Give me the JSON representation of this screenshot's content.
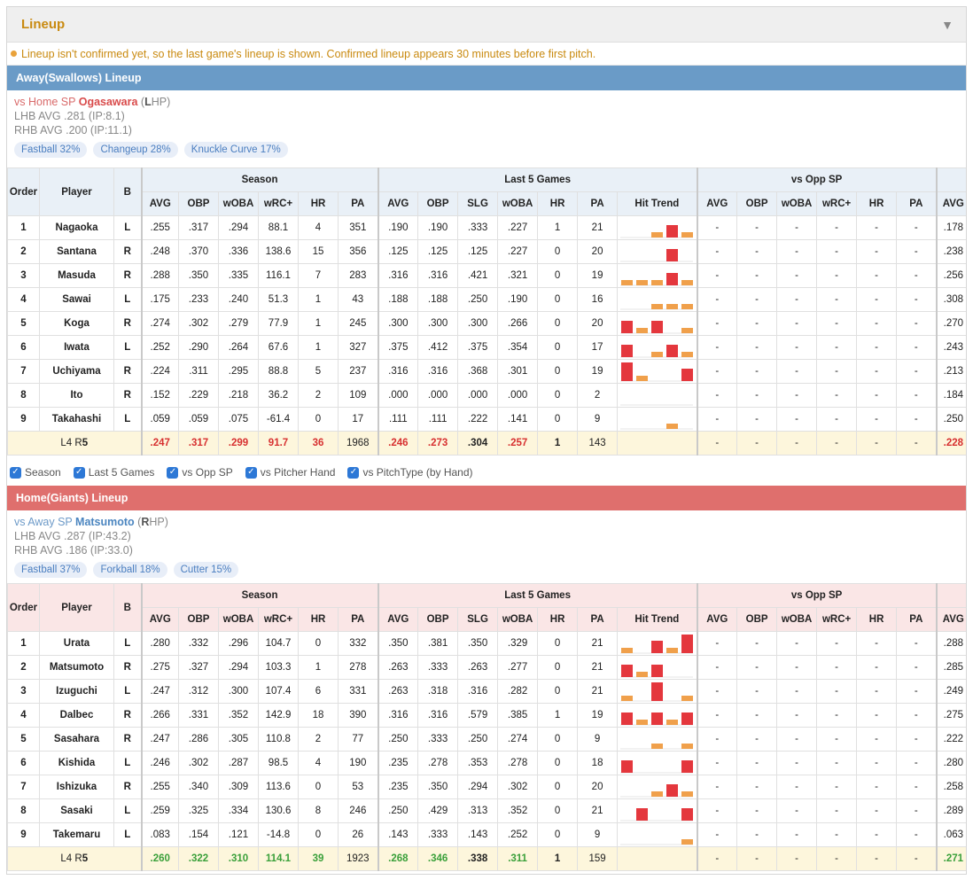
{
  "panel": {
    "title": "Lineup",
    "notice": "Lineup isn't confirmed yet, so the last game's lineup is shown. Confirmed lineup appears 30 minutes before first pitch."
  },
  "headers": {
    "order": "Order",
    "player": "Player",
    "bat": "B",
    "groups": {
      "season": "Season",
      "last5": "Last 5 Games",
      "vsopp": "vs Opp SP"
    },
    "season_cols": [
      "AVG",
      "OBP",
      "wOBA",
      "wRC+",
      "HR",
      "PA"
    ],
    "last5_cols": [
      "AVG",
      "OBP",
      "SLG",
      "wOBA",
      "HR",
      "PA",
      "Hit Trend"
    ],
    "vsopp_cols": [
      "AVG",
      "OBP",
      "wOBA",
      "wRC+",
      "HR",
      "PA"
    ],
    "extra_col": "AVG"
  },
  "checkboxes": [
    "Season",
    "Last 5 Games",
    "vs Opp SP",
    "vs Pitcher Hand",
    "vs PitchType (by Hand)"
  ],
  "colors": {
    "hit_trend_high": "#e4373d",
    "hit_trend_low": "#f0a04b",
    "away": "#6a9bc7",
    "home": "#df6f6d"
  },
  "away": {
    "bar": "Away(Swallows) Lineup",
    "sp_prefix": "vs Home SP ",
    "sp_name": "Ogasawara",
    "sp_hand_pre": " (",
    "sp_hand": "L",
    "sp_hand_post": "HP)",
    "lhb": "LHB AVG .281 (IP:8.1)",
    "rhb": "RHB AVG .200 (IP:11.1)",
    "pitches": [
      "Fastball 32%",
      "Changeup 28%",
      "Knuckle Curve 17%"
    ],
    "rows": [
      {
        "o": "1",
        "n": "Nagaoka",
        "b": "L",
        "s": [
          ".255",
          ".317",
          ".294",
          "88.1",
          "4",
          "351"
        ],
        "l": [
          ".190",
          ".190",
          ".333",
          ".227",
          "1",
          "21"
        ],
        "t": [
          0,
          0,
          1,
          2,
          1
        ],
        "v": [
          "-",
          "-",
          "-",
          "-",
          "-",
          "-"
        ],
        "x": ".178"
      },
      {
        "o": "2",
        "n": "Santana",
        "b": "R",
        "s": [
          ".248",
          ".370",
          ".336",
          "138.6",
          "15",
          "356"
        ],
        "l": [
          ".125",
          ".125",
          ".125",
          ".227",
          "0",
          "20"
        ],
        "t": [
          0,
          0,
          0,
          2,
          0
        ],
        "v": [
          "-",
          "-",
          "-",
          "-",
          "-",
          "-"
        ],
        "x": ".238"
      },
      {
        "o": "3",
        "n": "Masuda",
        "b": "R",
        "s": [
          ".288",
          ".350",
          ".335",
          "116.1",
          "7",
          "283"
        ],
        "l": [
          ".316",
          ".316",
          ".421",
          ".321",
          "0",
          "19"
        ],
        "t": [
          1,
          1,
          1,
          2,
          1
        ],
        "v": [
          "-",
          "-",
          "-",
          "-",
          "-",
          "-"
        ],
        "x": ".256"
      },
      {
        "o": "4",
        "n": "Sawai",
        "b": "L",
        "s": [
          ".175",
          ".233",
          ".240",
          "51.3",
          "1",
          "43"
        ],
        "l": [
          ".188",
          ".188",
          ".250",
          ".190",
          "0",
          "16"
        ],
        "t": [
          0,
          0,
          1,
          1,
          1
        ],
        "v": [
          "-",
          "-",
          "-",
          "-",
          "-",
          "-"
        ],
        "x": ".308"
      },
      {
        "o": "5",
        "n": "Koga",
        "b": "R",
        "s": [
          ".274",
          ".302",
          ".279",
          "77.9",
          "1",
          "245"
        ],
        "l": [
          ".300",
          ".300",
          ".300",
          ".266",
          "0",
          "20"
        ],
        "t": [
          2,
          1,
          2,
          0,
          1
        ],
        "v": [
          "-",
          "-",
          "-",
          "-",
          "-",
          "-"
        ],
        "x": ".270"
      },
      {
        "o": "6",
        "n": "Iwata",
        "b": "L",
        "s": [
          ".252",
          ".290",
          ".264",
          "67.6",
          "1",
          "327"
        ],
        "l": [
          ".375",
          ".412",
          ".375",
          ".354",
          "0",
          "17"
        ],
        "t": [
          2,
          0,
          1,
          2,
          1
        ],
        "v": [
          "-",
          "-",
          "-",
          "-",
          "-",
          "-"
        ],
        "x": ".243"
      },
      {
        "o": "7",
        "n": "Uchiyama",
        "b": "R",
        "s": [
          ".224",
          ".311",
          ".295",
          "88.8",
          "5",
          "237"
        ],
        "l": [
          ".316",
          ".316",
          ".368",
          ".301",
          "0",
          "19"
        ],
        "t": [
          3,
          1,
          0,
          0,
          2
        ],
        "v": [
          "-",
          "-",
          "-",
          "-",
          "-",
          "-"
        ],
        "x": ".213"
      },
      {
        "o": "8",
        "n": "Ito",
        "b": "R",
        "s": [
          ".152",
          ".229",
          ".218",
          "36.2",
          "2",
          "109"
        ],
        "l": [
          ".000",
          ".000",
          ".000",
          ".000",
          "0",
          "2"
        ],
        "t": [
          0,
          0,
          0,
          0,
          0
        ],
        "v": [
          "-",
          "-",
          "-",
          "-",
          "-",
          "-"
        ],
        "x": ".184"
      },
      {
        "o": "9",
        "n": "Takahashi",
        "b": "L",
        "s": [
          ".059",
          ".059",
          ".075",
          "-61.4",
          "0",
          "17"
        ],
        "l": [
          ".111",
          ".111",
          ".222",
          ".141",
          "0",
          "9"
        ],
        "t": [
          0,
          0,
          0,
          1,
          0
        ],
        "v": [
          "-",
          "-",
          "-",
          "-",
          "-",
          "-"
        ],
        "x": ".250"
      }
    ],
    "total": {
      "hand_l": "L4 R",
      "hand_r": "5",
      "s": [
        ".247",
        ".317",
        ".299",
        "91.7",
        "36",
        "1968"
      ],
      "l": [
        ".246",
        ".273",
        ".304",
        ".257",
        "1",
        "143"
      ],
      "v": [
        "-",
        "-",
        "-",
        "-",
        "-",
        "-"
      ],
      "x": ".228"
    }
  },
  "home": {
    "bar": "Home(Giants) Lineup",
    "sp_prefix": "vs Away SP ",
    "sp_name": "Matsumoto",
    "sp_hand_pre": " (",
    "sp_hand": "R",
    "sp_hand_post": "HP)",
    "lhb": "LHB AVG .287 (IP:43.2)",
    "rhb": "RHB AVG .186 (IP:33.0)",
    "pitches": [
      "Fastball 37%",
      "Forkball 18%",
      "Cutter 15%"
    ],
    "rows": [
      {
        "o": "1",
        "n": "Urata",
        "b": "L",
        "s": [
          ".280",
          ".332",
          ".296",
          "104.7",
          "0",
          "332"
        ],
        "l": [
          ".350",
          ".381",
          ".350",
          ".329",
          "0",
          "21"
        ],
        "t": [
          1,
          0,
          2,
          1,
          3
        ],
        "v": [
          "-",
          "-",
          "-",
          "-",
          "-",
          "-"
        ],
        "x": ".288"
      },
      {
        "o": "2",
        "n": "Matsumoto",
        "b": "R",
        "s": [
          ".275",
          ".327",
          ".294",
          "103.3",
          "1",
          "278"
        ],
        "l": [
          ".263",
          ".333",
          ".263",
          ".277",
          "0",
          "21"
        ],
        "t": [
          2,
          1,
          2,
          0,
          0
        ],
        "v": [
          "-",
          "-",
          "-",
          "-",
          "-",
          "-"
        ],
        "x": ".285"
      },
      {
        "o": "3",
        "n": "Izuguchi",
        "b": "L",
        "s": [
          ".247",
          ".312",
          ".300",
          "107.4",
          "6",
          "331"
        ],
        "l": [
          ".263",
          ".318",
          ".316",
          ".282",
          "0",
          "21"
        ],
        "t": [
          1,
          0,
          3,
          0,
          1
        ],
        "v": [
          "-",
          "-",
          "-",
          "-",
          "-",
          "-"
        ],
        "x": ".249"
      },
      {
        "o": "4",
        "n": "Dalbec",
        "b": "R",
        "s": [
          ".266",
          ".331",
          ".352",
          "142.9",
          "18",
          "390"
        ],
        "l": [
          ".316",
          ".316",
          ".579",
          ".385",
          "1",
          "19"
        ],
        "t": [
          2,
          1,
          2,
          1,
          2
        ],
        "v": [
          "-",
          "-",
          "-",
          "-",
          "-",
          "-"
        ],
        "x": ".275"
      },
      {
        "o": "5",
        "n": "Sasahara",
        "b": "R",
        "s": [
          ".247",
          ".286",
          ".305",
          "110.8",
          "2",
          "77"
        ],
        "l": [
          ".250",
          ".333",
          ".250",
          ".274",
          "0",
          "9"
        ],
        "t": [
          0,
          0,
          1,
          0,
          1
        ],
        "v": [
          "-",
          "-",
          "-",
          "-",
          "-",
          "-"
        ],
        "x": ".222"
      },
      {
        "o": "6",
        "n": "Kishida",
        "b": "L",
        "s": [
          ".246",
          ".302",
          ".287",
          "98.5",
          "4",
          "190"
        ],
        "l": [
          ".235",
          ".278",
          ".353",
          ".278",
          "0",
          "18"
        ],
        "t": [
          2,
          0,
          0,
          0,
          2
        ],
        "v": [
          "-",
          "-",
          "-",
          "-",
          "-",
          "-"
        ],
        "x": ".280"
      },
      {
        "o": "7",
        "n": "Ishizuka",
        "b": "R",
        "s": [
          ".255",
          ".340",
          ".309",
          "113.6",
          "0",
          "53"
        ],
        "l": [
          ".235",
          ".350",
          ".294",
          ".302",
          "0",
          "20"
        ],
        "t": [
          0,
          0,
          1,
          2,
          1
        ],
        "v": [
          "-",
          "-",
          "-",
          "-",
          "-",
          "-"
        ],
        "x": ".258"
      },
      {
        "o": "8",
        "n": "Sasaki",
        "b": "L",
        "s": [
          ".259",
          ".325",
          ".334",
          "130.6",
          "8",
          "246"
        ],
        "l": [
          ".250",
          ".429",
          ".313",
          ".352",
          "0",
          "21"
        ],
        "t": [
          0,
          2,
          0,
          0,
          2
        ],
        "v": [
          "-",
          "-",
          "-",
          "-",
          "-",
          "-"
        ],
        "x": ".289"
      },
      {
        "o": "9",
        "n": "Takemaru",
        "b": "L",
        "s": [
          ".083",
          ".154",
          ".121",
          "-14.8",
          "0",
          "26"
        ],
        "l": [
          ".143",
          ".333",
          ".143",
          ".252",
          "0",
          "9"
        ],
        "t": [
          0,
          0,
          0,
          0,
          1
        ],
        "v": [
          "-",
          "-",
          "-",
          "-",
          "-",
          "-"
        ],
        "x": ".063"
      }
    ],
    "total": {
      "hand_l": "L4 R",
      "hand_r": "5",
      "s": [
        ".260",
        ".322",
        ".310",
        "114.1",
        "39",
        "1923"
      ],
      "l": [
        ".268",
        ".346",
        ".338",
        ".311",
        "1",
        "159"
      ],
      "v": [
        "-",
        "-",
        "-",
        "-",
        "-",
        "-"
      ],
      "x": ".271"
    }
  }
}
